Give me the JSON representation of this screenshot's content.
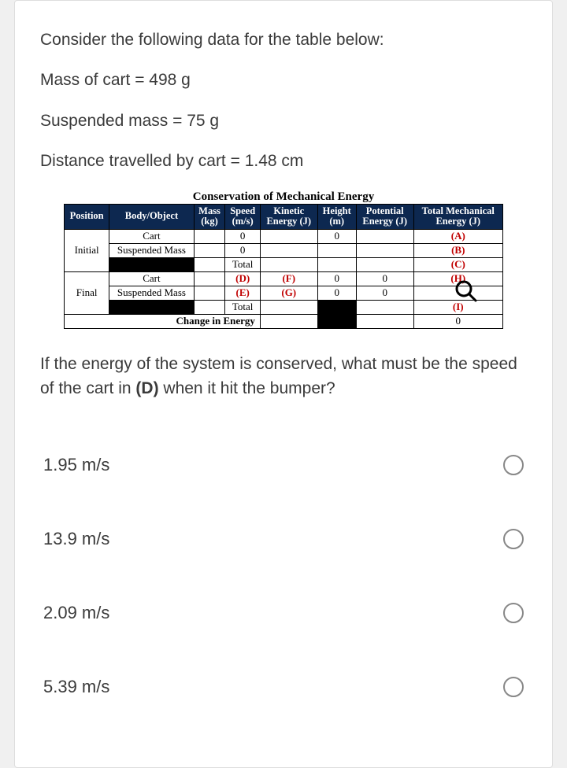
{
  "intro": {
    "line1": "Consider the following data for the table below:",
    "line2": "Mass of cart = 498 g",
    "line3": "Suspended mass = 75 g",
    "line4": "Distance travelled by cart = 1.48 cm"
  },
  "table": {
    "title": "Conservation of Mechanical Energy",
    "headers": {
      "position": "Position",
      "body": "Body/Object",
      "mass": "Mass (kg)",
      "mass1": "Mass",
      "mass2": "(kg)",
      "speed1": "Speed",
      "speed2": "(m/s)",
      "ke1": "Kinetic",
      "ke2": "Energy (J)",
      "height1": "Height",
      "height2": "(m)",
      "pe1": "Potential",
      "pe2": "Energy (J)",
      "tme1": "Total Mechanical",
      "tme2": "Energy (J)"
    },
    "rows": {
      "initial": "Initial",
      "final": "Final",
      "cart": "Cart",
      "susp": "Suspended Mass",
      "total": "Total",
      "change": "Change in Energy",
      "zero": "0",
      "A": "(A)",
      "B": "(B)",
      "C": "(C)",
      "D": "(D)",
      "E": "(E)",
      "F": "(F)",
      "G": "(G)",
      "H": "(H)",
      "I": "(I)"
    }
  },
  "question": {
    "part1": "If the energy of the system is conserved, what must be the speed of the cart in ",
    "bold": "(D)",
    "part2": " when it hit the bumper?"
  },
  "options": {
    "a": "1.95 m/s",
    "b": "13.9 m/s",
    "c": "2.09 m/s",
    "d": "5.39 m/s"
  }
}
